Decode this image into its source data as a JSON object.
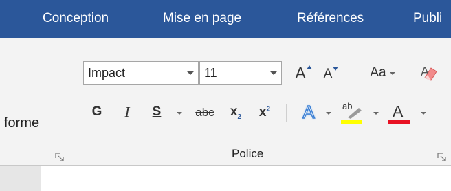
{
  "tabs": [
    {
      "label": "Conception"
    },
    {
      "label": "Mise en page"
    },
    {
      "label": "Références"
    },
    {
      "label": "Publi"
    }
  ],
  "left_group": {
    "label": "forme"
  },
  "font_group": {
    "label": "Police",
    "font_name": "Impact",
    "font_size": "11",
    "change_case_label": "Aa",
    "bold_label": "G",
    "italic_label": "I",
    "underline_label": "S",
    "strikethrough_label": "abc",
    "subscript_label": "x",
    "subscript_mark": "2",
    "superscript_label": "x",
    "superscript_mark": "2",
    "text_effects_label": "A",
    "highlight_label": "ab",
    "font_color_label": "A",
    "grow_label": "A",
    "shrink_label": "A"
  },
  "colors": {
    "tabbar": "#2b579a",
    "highlight": "#ffff00",
    "font_color": "#e81123",
    "text_effect": "#3b7fd4"
  },
  "icons": [
    "grow-font-icon",
    "shrink-font-icon",
    "change-case-icon",
    "clear-formatting-icon",
    "dialog-launcher-icon",
    "text-effects-icon",
    "highlight-icon",
    "font-color-icon"
  ]
}
